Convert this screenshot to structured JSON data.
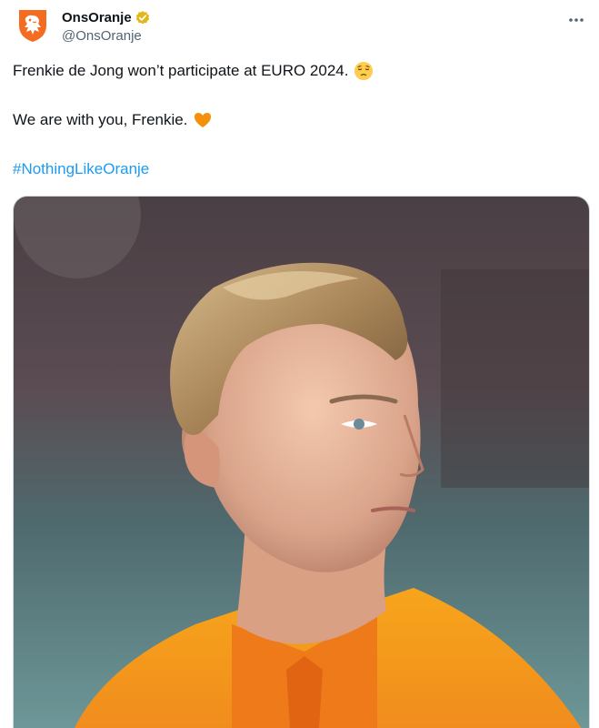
{
  "author": {
    "display_name": "OnsOranje",
    "handle": "@OnsOranje",
    "verified_icon": "gold-verified-badge",
    "avatar_icon": "knvb-lion-crest"
  },
  "menu": {
    "icon": "more-horizontal-icon"
  },
  "tweet": {
    "line1": "Frenkie de Jong won’t participate at EURO 2024.",
    "line1_emoji": "pensive-face-emoji",
    "line2": "We are with you, Frenkie.",
    "line2_emoji": "orange-heart-emoji",
    "hashtag": "#NothingLikeOranje"
  },
  "media": {
    "description_icon": "player-portrait-photo"
  },
  "colors": {
    "hashtag": "#1d9bf0",
    "handle": "#536471",
    "brand_orange": "#f36c21",
    "verified_gold": "#e2b719"
  }
}
